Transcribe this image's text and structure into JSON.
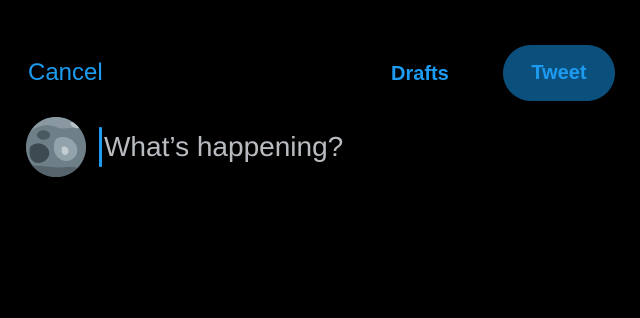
{
  "header": {
    "cancel_label": "Cancel",
    "drafts_label": "Drafts",
    "tweet_label": "Tweet"
  },
  "composer": {
    "placeholder": "What’s happening?",
    "value": "",
    "avatar_icon": "profile-photo-icon"
  },
  "colors": {
    "background": "#000000",
    "accent": "#1d9bf0",
    "tweet_button_bg": "#0b4f7c",
    "placeholder": "#b8bcc0"
  }
}
